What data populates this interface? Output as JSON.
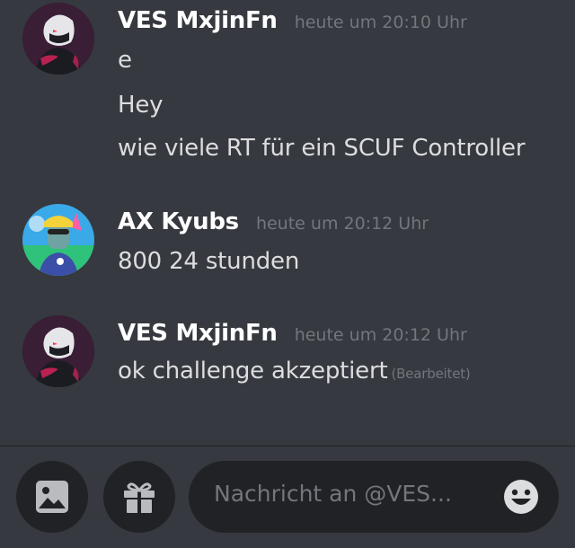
{
  "messages": [
    {
      "author": "VES MxjinFn",
      "timestamp": "heute um 20:10 Uhr",
      "avatar": "ninja-avatar",
      "lines": [
        "e",
        "Hey",
        "wie viele RT für ein SCUF Controller"
      ]
    },
    {
      "author": "AX Kyubs",
      "timestamp": "heute um 20:12 Uhr",
      "avatar": "beach-avatar",
      "lines": [
        "800  24 stunden"
      ]
    },
    {
      "author": "VES MxjinFn",
      "timestamp": "heute um 20:12 Uhr",
      "avatar": "ninja-avatar",
      "lines": [
        "ok challenge akzeptiert"
      ],
      "edited_label": "(Bearbeitet)"
    }
  ],
  "composer": {
    "placeholder": "Nachricht an @VES...",
    "icons": [
      "image-icon",
      "gift-icon",
      "emoji-icon"
    ]
  },
  "colors": {
    "background": "#36393f",
    "input": "#202225",
    "author": "#ffffff",
    "text": "#dcddde",
    "muted": "#72767d"
  }
}
